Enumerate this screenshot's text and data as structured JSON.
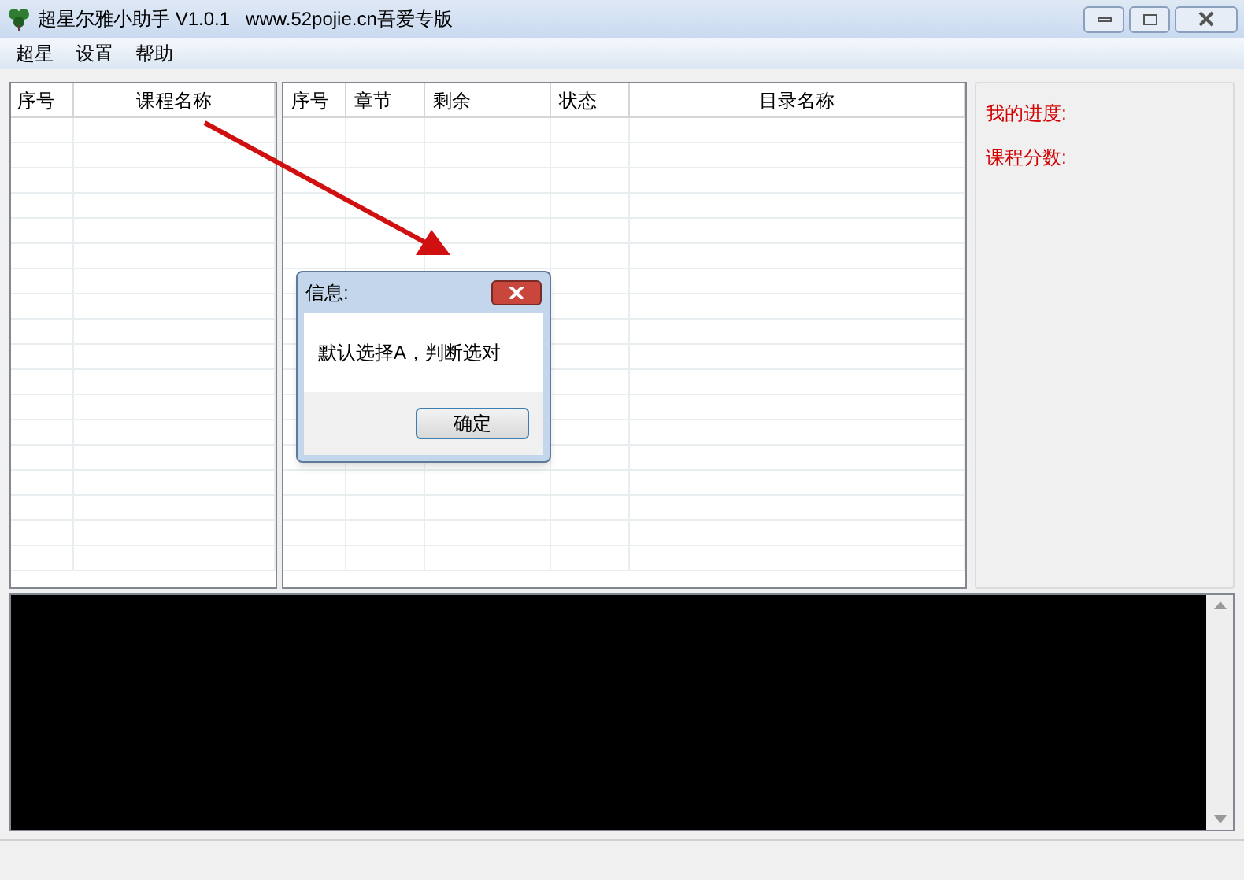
{
  "window": {
    "title": "超星尔雅小助手 V1.0.1   www.52pojie.cn吾爱专版"
  },
  "menu": [
    "超星",
    "设置",
    "帮助"
  ],
  "course_table": {
    "columns": [
      "序号",
      "课程名称"
    ]
  },
  "chapter_table": {
    "columns": [
      "序号",
      "章节",
      "剩余",
      "状态",
      "目录名称"
    ]
  },
  "info_panel": {
    "labels": [
      "我的进度:",
      "课程分数:"
    ]
  },
  "dialog": {
    "title": "信息:",
    "message": "默认选择A，判断选对",
    "button": "确定"
  }
}
